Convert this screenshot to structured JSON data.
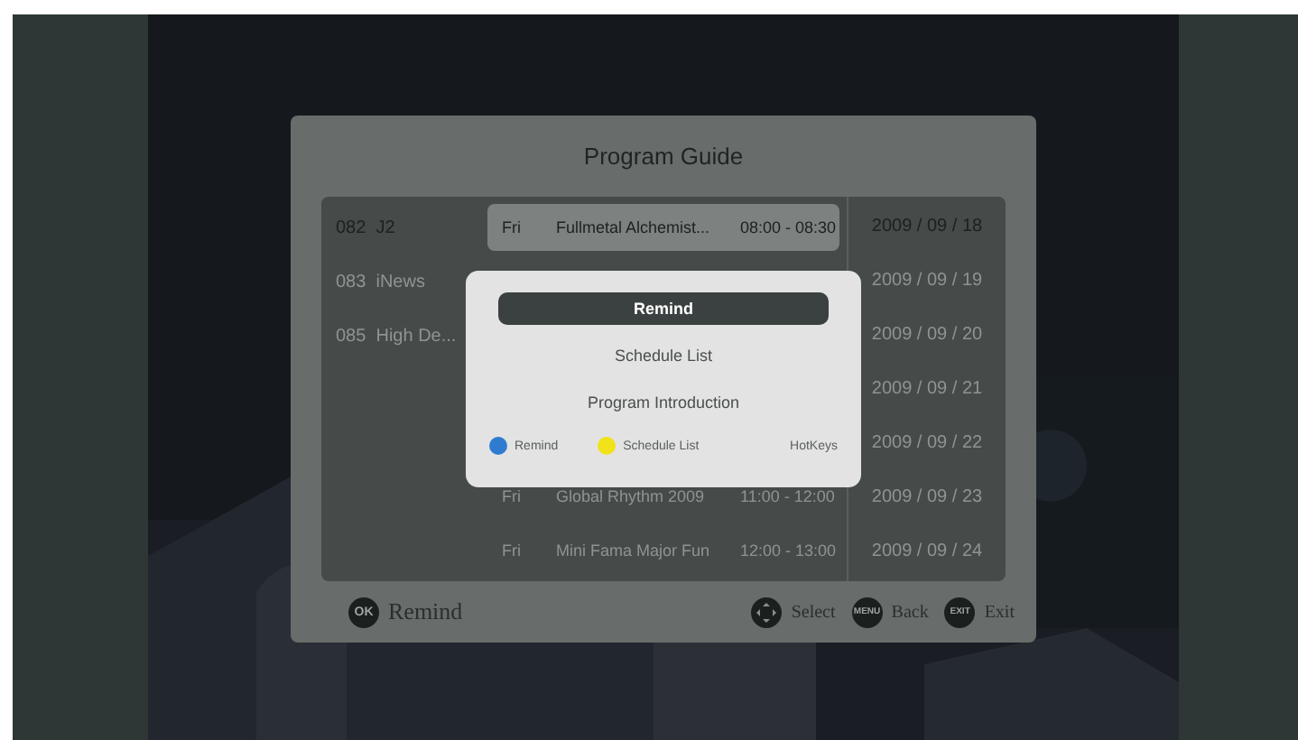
{
  "guide": {
    "title": "Program Guide",
    "channels": [
      {
        "label": "082  J2",
        "selected": true
      },
      {
        "label": "083  iNews",
        "selected": false
      },
      {
        "label": "085  High De...",
        "selected": false
      }
    ],
    "programs": [
      {
        "day": "Fri",
        "name": "Fullmetal Alchemist...",
        "time": "08:00 - 08:30",
        "selected": true
      },
      {
        "day": "Fri",
        "name": "Global Rhythm 2009",
        "time": "11:00 - 12:00",
        "selected": false
      },
      {
        "day": "Fri",
        "name": "Mini Fama Major Fun",
        "time": "12:00 - 13:00",
        "selected": false
      }
    ],
    "dates": [
      {
        "label": "2009 / 09 / 18",
        "selected": true
      },
      {
        "label": "2009 / 09 / 19",
        "selected": false
      },
      {
        "label": "2009 / 09 / 20",
        "selected": false
      },
      {
        "label": "2009 / 09 / 21",
        "selected": false
      },
      {
        "label": "2009 / 09 / 22",
        "selected": false
      },
      {
        "label": "2009 / 09 / 23",
        "selected": false
      },
      {
        "label": "2009 / 09 / 24",
        "selected": false
      }
    ]
  },
  "popup": {
    "items": [
      {
        "label": "Remind",
        "selected": true
      },
      {
        "label": "Schedule List",
        "selected": false
      },
      {
        "label": "Program Introduction",
        "selected": false
      }
    ],
    "hotkeys": [
      {
        "label": "Remind",
        "color": "#2f7bd0"
      },
      {
        "label": "Schedule List",
        "color": "#f2e21a"
      }
    ],
    "hotkeys_label": "HotKeys"
  },
  "footer": {
    "left": [
      {
        "key": "OK",
        "label": "Remind",
        "kind": "chip"
      }
    ],
    "right": [
      {
        "label": "Select",
        "kind": "dpad"
      },
      {
        "key": "MENU",
        "label": "Back",
        "kind": "chip"
      },
      {
        "key": "EXIT",
        "label": "Exit",
        "kind": "chip"
      }
    ]
  }
}
